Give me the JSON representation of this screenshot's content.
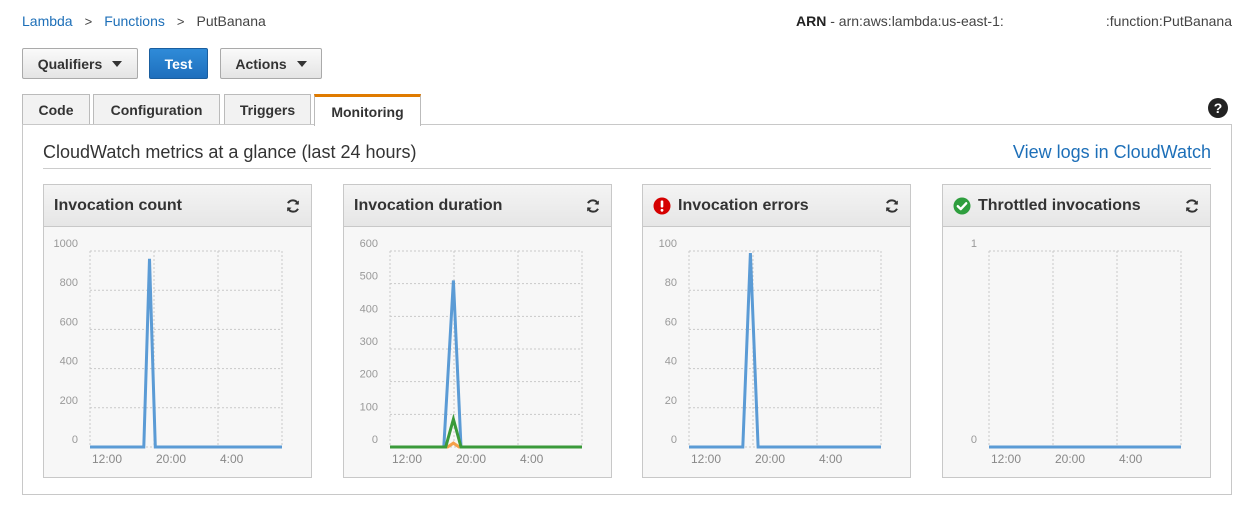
{
  "breadcrumb": {
    "lambda": "Lambda",
    "functions": "Functions",
    "current": "PutBanana",
    "separator": ">"
  },
  "arn": {
    "label": "ARN",
    "prefix": "- arn:aws:lambda:us-east-1:",
    "suffix": ":function:PutBanana"
  },
  "toolbar": {
    "qualifiers": "Qualifiers",
    "test": "Test",
    "actions": "Actions"
  },
  "tabs": [
    {
      "label": "Code"
    },
    {
      "label": "Configuration"
    },
    {
      "label": "Triggers"
    },
    {
      "label": "Monitoring",
      "active": true
    }
  ],
  "help_icon": "question-circle-icon",
  "monitoring": {
    "title": "CloudWatch metrics at a glance (last 24 hours)",
    "view_logs": "View logs in CloudWatch"
  },
  "colors": {
    "link": "#1d6fb8",
    "tab_accent": "#e07b00",
    "series_blue": "#5b9bd5",
    "series_orange": "#f5a04a",
    "series_green": "#3a9a3a",
    "error_red": "#d50000",
    "ok_green": "#2e9e3e"
  },
  "chart_data": [
    {
      "type": "line",
      "title": "Invocation count",
      "status_icon": null,
      "x_ticks": [
        "12:00",
        "20:00",
        "4:00"
      ],
      "y_ticks": [
        "0",
        "200",
        "400",
        "600",
        "800",
        "1000"
      ],
      "ylim": [
        0,
        1000
      ],
      "series": [
        {
          "color": "#5b9bd5",
          "points": [
            [
              0,
              0
            ],
            [
              0.28,
              0
            ],
            [
              0.31,
              960
            ],
            [
              0.34,
              0
            ],
            [
              1,
              0
            ]
          ]
        }
      ]
    },
    {
      "type": "line",
      "title": "Invocation duration",
      "status_icon": null,
      "x_ticks": [
        "12:00",
        "20:00",
        "4:00"
      ],
      "y_ticks": [
        "0",
        "100",
        "200",
        "300",
        "400",
        "500",
        "600"
      ],
      "ylim": [
        0,
        600
      ],
      "series": [
        {
          "color": "#5b9bd5",
          "points": [
            [
              0,
              0
            ],
            [
              0.28,
              0
            ],
            [
              0.33,
              510
            ],
            [
              0.37,
              0
            ],
            [
              1,
              0
            ]
          ]
        },
        {
          "color": "#f5a04a",
          "points": [
            [
              0,
              0
            ],
            [
              0.3,
              0
            ],
            [
              0.33,
              12
            ],
            [
              0.36,
              0
            ],
            [
              1,
              0
            ]
          ]
        },
        {
          "color": "#3a9a3a",
          "points": [
            [
              0,
              0
            ],
            [
              0.29,
              0
            ],
            [
              0.33,
              85
            ],
            [
              0.37,
              0
            ],
            [
              1,
              0
            ]
          ]
        }
      ]
    },
    {
      "type": "line",
      "title": "Invocation errors",
      "status_icon": "error-icon",
      "x_ticks": [
        "12:00",
        "20:00",
        "4:00"
      ],
      "y_ticks": [
        "0",
        "20",
        "40",
        "60",
        "80",
        "100"
      ],
      "ylim": [
        0,
        100
      ],
      "series": [
        {
          "color": "#5b9bd5",
          "points": [
            [
              0,
              0
            ],
            [
              0.28,
              0
            ],
            [
              0.32,
              99
            ],
            [
              0.36,
              0
            ],
            [
              1,
              0
            ]
          ]
        }
      ]
    },
    {
      "type": "line",
      "title": "Throttled invocations",
      "status_icon": "ok-icon",
      "x_ticks": [
        "12:00",
        "20:00",
        "4:00"
      ],
      "y_ticks": [
        "0",
        "1"
      ],
      "ylim": [
        0,
        1
      ],
      "series": [
        {
          "color": "#5b9bd5",
          "points": [
            [
              0,
              0
            ],
            [
              1,
              0
            ]
          ]
        }
      ]
    }
  ]
}
